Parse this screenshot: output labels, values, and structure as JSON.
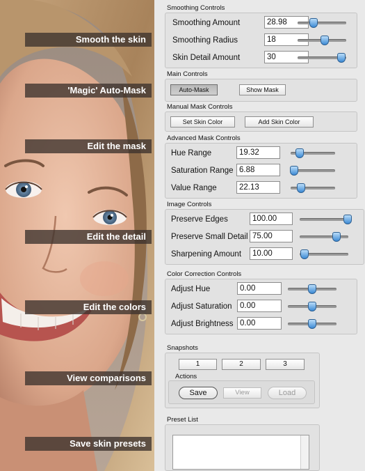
{
  "callouts": [
    "Smooth the skin",
    "'Magic' Auto-Mask",
    "Edit the mask",
    "Edit the detail",
    "Edit the colors",
    "View comparisons",
    "Save skin presets"
  ],
  "smoothing": {
    "title": "Smoothing Controls",
    "rows": [
      {
        "label": "Smoothing Amount",
        "value": "28.98",
        "slider": 0.33
      },
      {
        "label": "Smoothing Radius",
        "value": "18",
        "slider": 0.55
      },
      {
        "label": "Skin Detail Amount",
        "value": "30",
        "slider": 0.9
      }
    ]
  },
  "main": {
    "title": "Main Controls",
    "auto_mask": "Auto-Mask",
    "show_mask": "Show Mask"
  },
  "manual": {
    "title": "Manual Mask Controls",
    "set_skin": "Set Skin Color",
    "add_skin": "Add Skin Color"
  },
  "advanced": {
    "title": "Advanced Mask Controls",
    "rows": [
      {
        "label": "Hue Range",
        "value": "19.32",
        "slider": 0.2
      },
      {
        "label": "Saturation Range",
        "value": "6.88",
        "slider": 0.08
      },
      {
        "label": "Value Range",
        "value": "22.13",
        "slider": 0.23
      }
    ]
  },
  "image": {
    "title": "Image Controls",
    "rows": [
      {
        "label": "Preserve Edges",
        "value": "100.00",
        "slider": 0.98
      },
      {
        "label": "Preserve Small Detail",
        "value": "75.00",
        "slider": 0.75
      },
      {
        "label": "Sharpening Amount",
        "value": "10.00",
        "slider": 0.1
      }
    ]
  },
  "color": {
    "title": "Color Correction Controls",
    "rows": [
      {
        "label": "Adjust Hue",
        "value": "0.00",
        "slider": 0.5
      },
      {
        "label": "Adjust Saturation",
        "value": "0.00",
        "slider": 0.5
      },
      {
        "label": "Adjust Brightness",
        "value": "0.00",
        "slider": 0.5
      }
    ]
  },
  "snapshots": {
    "title": "Snapshots",
    "buttons": [
      "1",
      "2",
      "3"
    ],
    "actions_title": "Actions",
    "save": "Save",
    "view": "View",
    "load": "Load"
  },
  "preset": {
    "title": "Preset List"
  }
}
